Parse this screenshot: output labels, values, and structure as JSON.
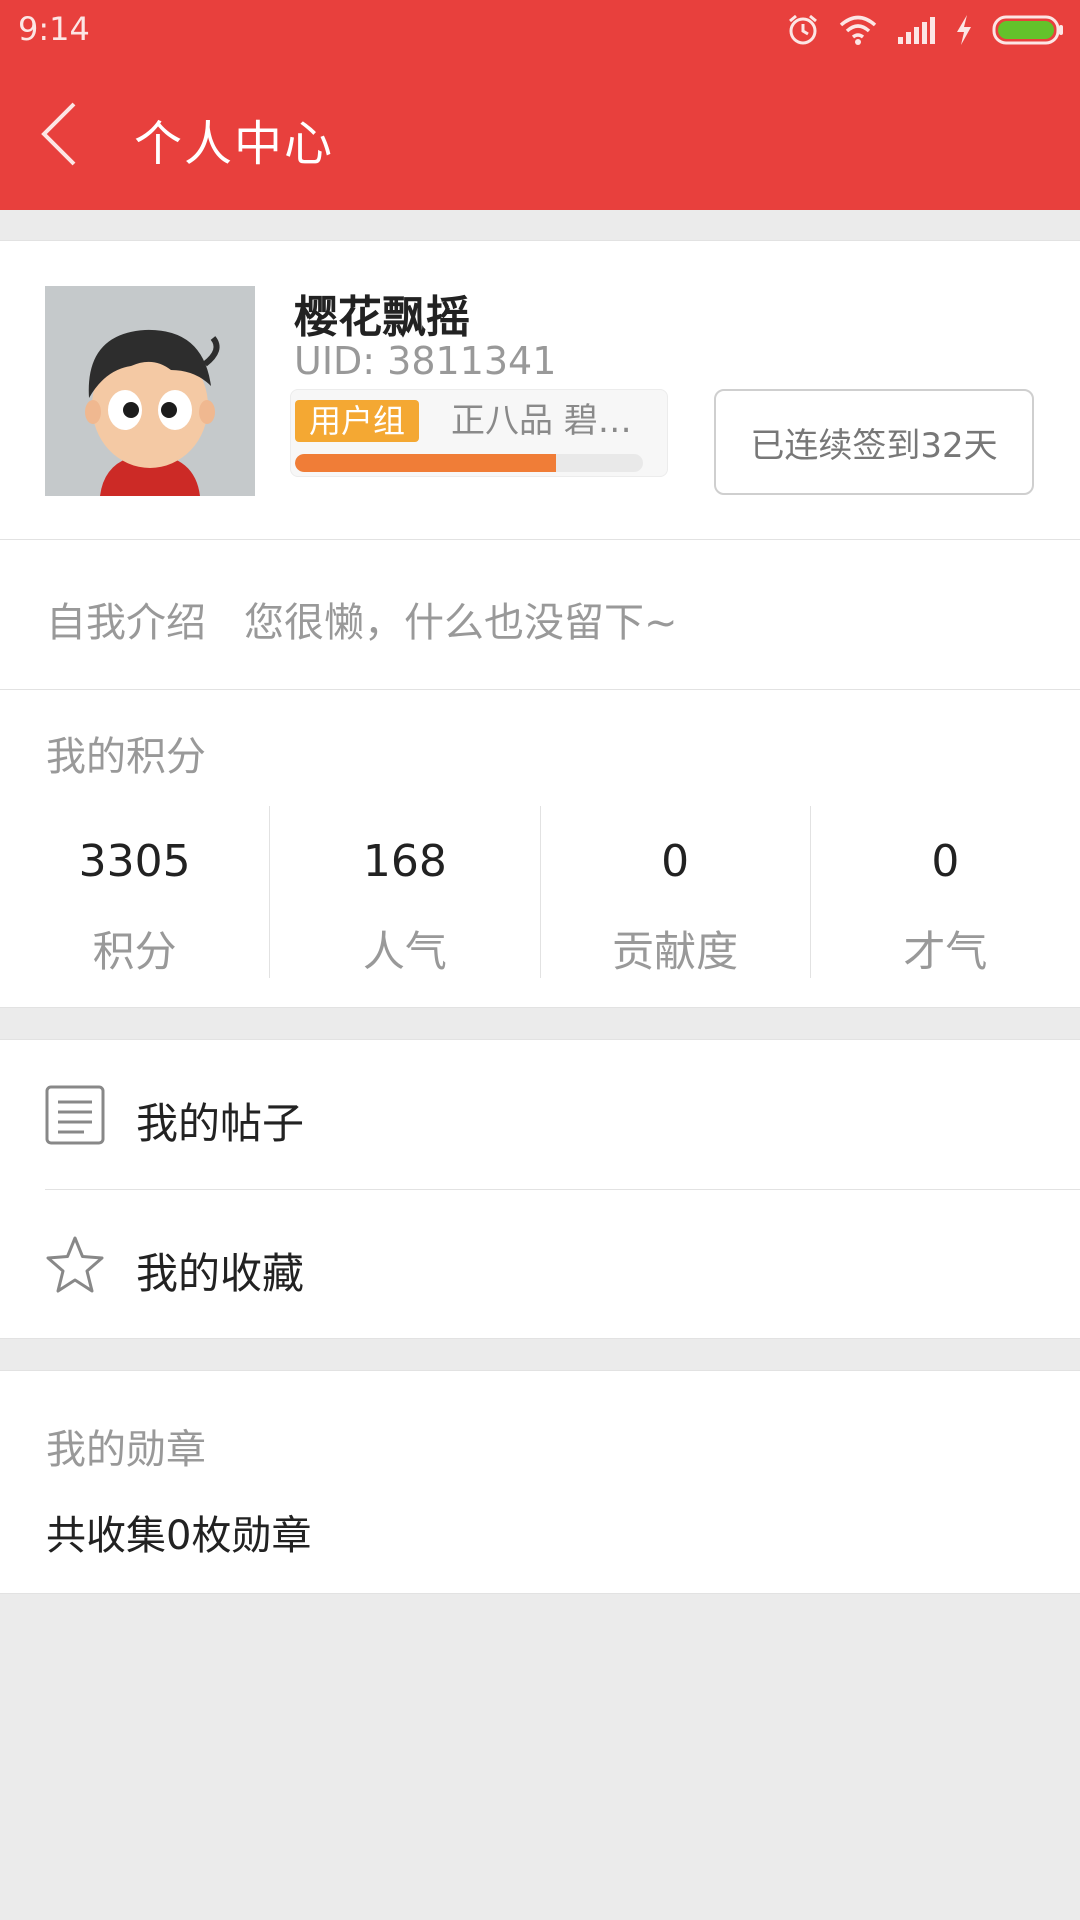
{
  "status_bar": {
    "time": "9:14",
    "icons": [
      "alarm-icon",
      "wifi-icon",
      "signal-icon",
      "charging-icon",
      "battery-icon"
    ]
  },
  "header": {
    "title": "个人中心",
    "back_icon": "back-chevron-icon"
  },
  "profile": {
    "username": "樱花飘摇",
    "uid": "UID: 3811341",
    "group_badge": "用户组",
    "group_rank": "正八品 碧…",
    "level_progress": 0.75,
    "checkin_label": "已连续签到32天"
  },
  "intro": {
    "label": "自我介绍",
    "text": "您很懒，什么也没留下~"
  },
  "points": {
    "title": "我的积分",
    "items": [
      {
        "value": "3305",
        "label": "积分"
      },
      {
        "value": "168",
        "label": "人气"
      },
      {
        "value": "0",
        "label": "贡献度"
      },
      {
        "value": "0",
        "label": "才气"
      }
    ]
  },
  "menu": {
    "items": [
      {
        "label": "我的帖子",
        "icon": "document-icon"
      },
      {
        "label": "我的收藏",
        "icon": "star-icon"
      }
    ]
  },
  "medals": {
    "title": "我的勋章",
    "count_text": "共收集0枚勋章"
  },
  "colors": {
    "brand": "#e8403d",
    "badge": "#f4a833",
    "progress": "#f07d37"
  }
}
